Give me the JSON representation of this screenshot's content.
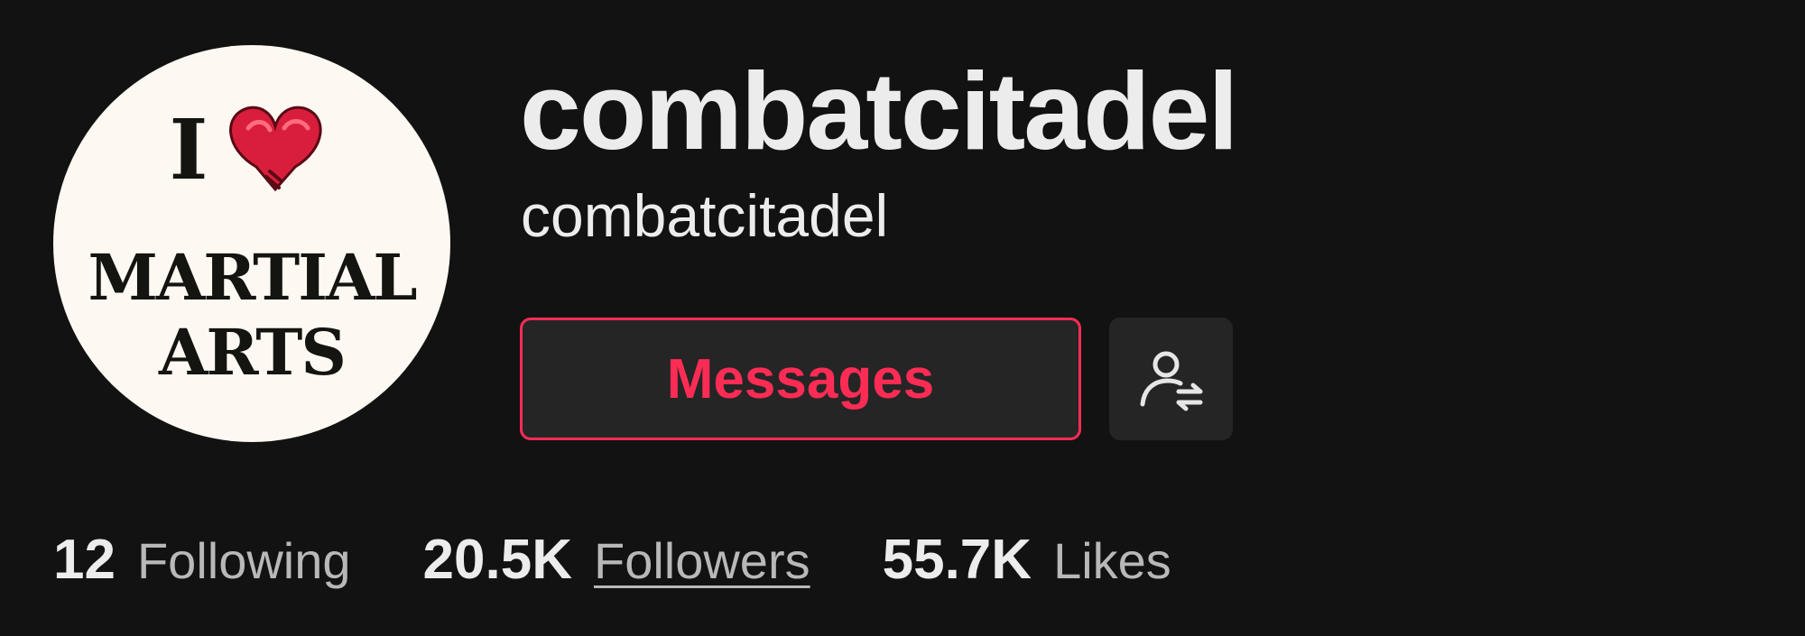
{
  "profile": {
    "display_name": "combatcitadel",
    "username": "combatcitadel",
    "avatar": {
      "icon": "boxing-glove-heart-icon",
      "line1": "I",
      "line2": "MARTIAL",
      "line3": "ARTS"
    }
  },
  "actions": {
    "message_label": "Messages",
    "suggest_icon": "user-switch-icon"
  },
  "stats": [
    {
      "value": "12",
      "label": "Following"
    },
    {
      "value": "20.5K",
      "label": "Followers"
    },
    {
      "value": "55.7K",
      "label": "Likes"
    }
  ],
  "colors": {
    "background": "#121212",
    "accent": "#fe2c55",
    "button_bg": "#252525",
    "text_primary": "#ececec",
    "text_secondary": "#b8b8b8"
  }
}
